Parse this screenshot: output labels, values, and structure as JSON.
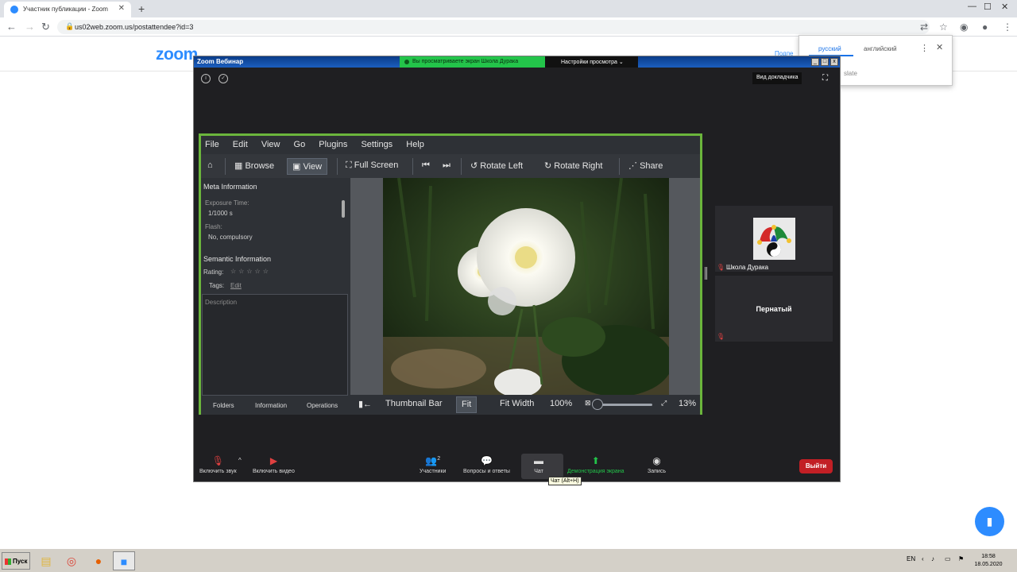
{
  "browser": {
    "tab_title": "Участник публикации - Zoom",
    "tab_close": "✕",
    "new_tab": "+",
    "url": "us02web.zoom.us/postattendee?id=3",
    "win_min": "—",
    "win_max": "☐",
    "win_close": "✕"
  },
  "translate_popup": {
    "lang_source": "русский",
    "lang_target": "английский",
    "translate_label": "slate"
  },
  "page": {
    "logo": "zoom",
    "header_link": "Подпе"
  },
  "zoom": {
    "window_title": "Zoom Вебинар",
    "share_banner": "Вы просматриваете экран Школа Дурака",
    "view_settings": "Настройки просмотра ⌄",
    "speaker_view": "Вид докладчика",
    "participants": [
      {
        "name": "Школа Дурака"
      },
      {
        "name": "Пернатый"
      }
    ],
    "toolbar": {
      "audio": "Включить звук",
      "video": "Включить видео",
      "participants": "Участники",
      "participants_count": "2",
      "qa": "Вопросы и ответы",
      "chat": "Чат",
      "share": "Демонстрация экрана",
      "record": "Запись",
      "leave": "Выйти"
    },
    "chat_tooltip": "Чат (Alt+H)"
  },
  "shared_app": {
    "menu": [
      "File",
      "Edit",
      "View",
      "Go",
      "Plugins",
      "Settings",
      "Help"
    ],
    "toolbar": {
      "browse": "Browse",
      "view": "View",
      "fullscreen": "Full Screen",
      "rotate_left": "Rotate Left",
      "rotate_right": "Rotate Right",
      "share": "Share"
    },
    "sidebar": {
      "meta_header": "Meta Information",
      "exposure_label": "Exposure Time:",
      "exposure_value": "1/1000 s",
      "flash_label": "Flash:",
      "flash_value": "No, compulsory",
      "semantic_header": "Semantic Information",
      "rating_label": "Rating:",
      "rating_stars": "☆☆☆☆☆",
      "tags_label": "Tags:",
      "tags_edit": "Edit",
      "description_placeholder": "Description",
      "tabs": [
        "Folders",
        "Information",
        "Operations"
      ]
    },
    "bottom": {
      "thumbnail_bar": "Thumbnail Bar",
      "fit": "Fit",
      "fit_width": "Fit Width",
      "zoom_100": "100%",
      "zoom_level": "13%"
    }
  },
  "taskbar": {
    "start": "Пуск",
    "lang": "EN",
    "time": "18:58",
    "date": "18.05.2020"
  },
  "colors": {
    "zoom_blue": "#2d8cff",
    "share_green": "#23c44a",
    "leave_red": "#c21f25",
    "app_border": "#6bb53c"
  }
}
